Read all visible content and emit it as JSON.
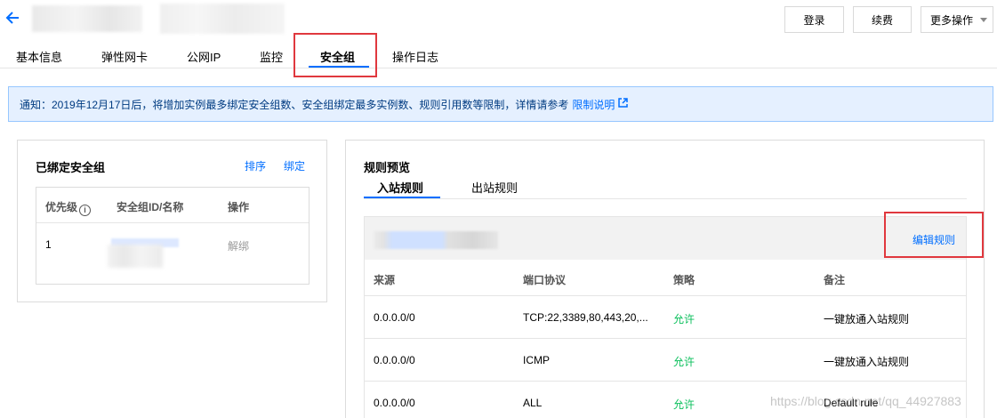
{
  "header": {
    "login_label": "登录",
    "renew_label": "续费",
    "more_label": "更多操作"
  },
  "tabs": [
    {
      "label": "基本信息"
    },
    {
      "label": "弹性网卡"
    },
    {
      "label": "公网IP"
    },
    {
      "label": "监控"
    },
    {
      "label": "安全组"
    },
    {
      "label": "操作日志"
    }
  ],
  "notice": {
    "text": "通知：2019年12月17日后，将增加实例最多绑定安全组数、安全组绑定最多实例数、规则引用数等限制，详情请参考",
    "link_label": "限制说明"
  },
  "bound_panel": {
    "title": "已绑定安全组",
    "sort_label": "排序",
    "bind_label": "绑定",
    "columns": [
      "优先级",
      "安全组ID/名称",
      "操作"
    ],
    "rows": [
      {
        "priority": "1",
        "action": "解绑"
      }
    ]
  },
  "preview_panel": {
    "title": "规则预览",
    "tabs": [
      {
        "label": "入站规则"
      },
      {
        "label": "出站规则"
      }
    ],
    "edit_label": "编辑规则",
    "columns": [
      "来源",
      "端口协议",
      "策略",
      "备注"
    ],
    "rows": [
      {
        "source": "0.0.0.0/0",
        "port": "TCP:22,3389,80,443,20,...",
        "policy": "允许",
        "remark": "一键放通入站规则"
      },
      {
        "source": "0.0.0.0/0",
        "port": "ICMP",
        "policy": "允许",
        "remark": "一键放通入站规则"
      },
      {
        "source": "0.0.0.0/0",
        "port": "ALL",
        "policy": "允许",
        "remark": "Default rule"
      }
    ]
  },
  "watermark": "https://blog.csdn.net/qq_44927883",
  "colors": {
    "accent": "#006eff",
    "allow": "#0abf5b",
    "highlight": "#e0383e",
    "notice_bg": "#e5f0ff"
  }
}
